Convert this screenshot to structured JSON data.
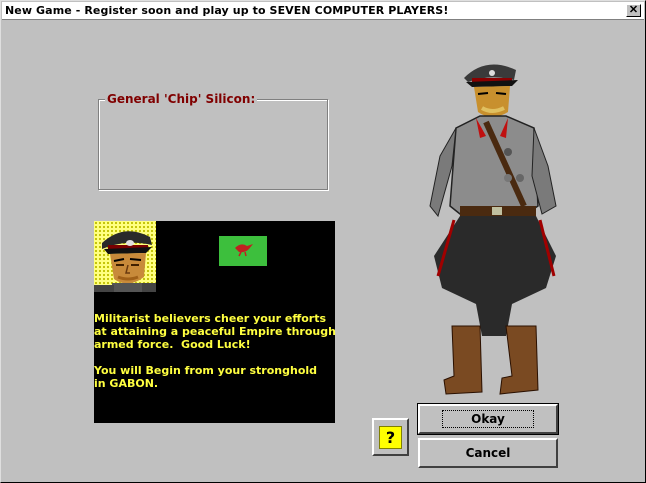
{
  "window": {
    "title": "New Game - Register soon and play up to SEVEN COMPUTER PLAYERS!",
    "close_symbol": "✕"
  },
  "general": {
    "name_label": "General 'Chip' Silicon:"
  },
  "info": {
    "message": "Militarist believers cheer your efforts\nat attaining a peaceful Empire through\narmed force.  Good Luck!\n\nYou will Begin from your stronghold\nin GABON.",
    "text_color": "#ffff40",
    "flag_color": "#3dbf3d",
    "flag_icon": "bird-emblem-icon"
  },
  "buttons": {
    "okay": "Okay",
    "cancel": "Cancel",
    "help": "?"
  },
  "icons": {
    "close": "close-icon",
    "help": "help-icon",
    "portrait": "general-portrait",
    "figure": "general-figure"
  }
}
